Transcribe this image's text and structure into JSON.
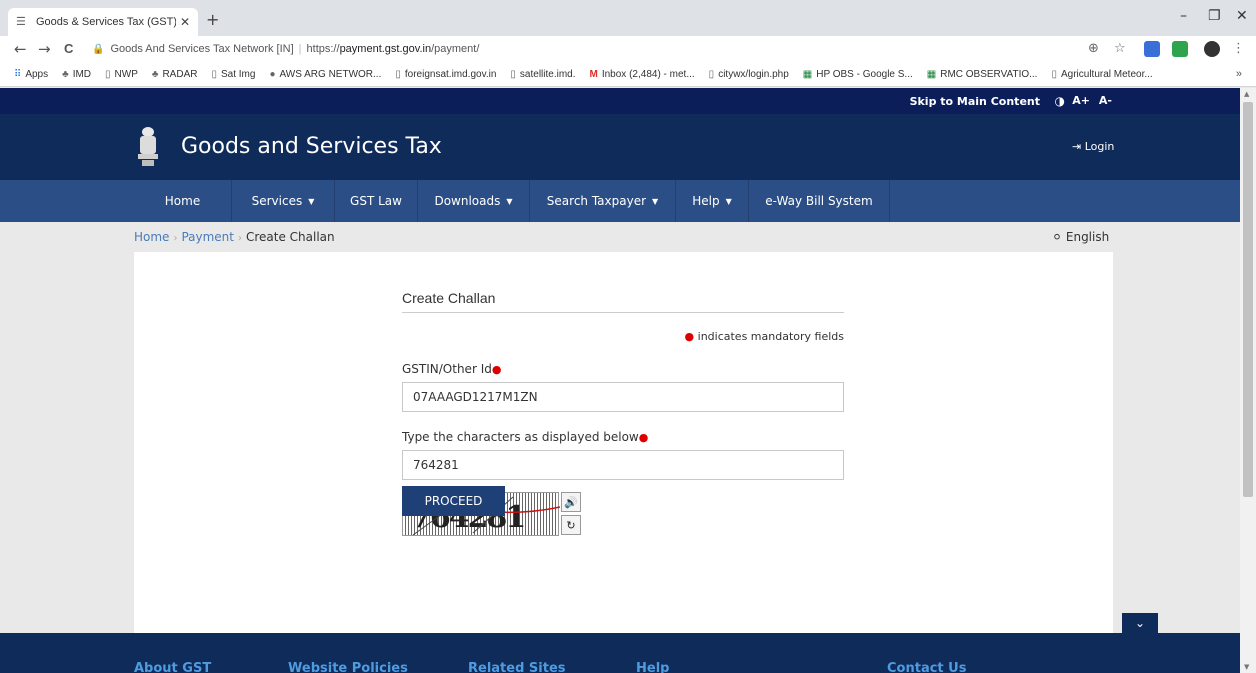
{
  "browser": {
    "tab_title": "Goods & Services Tax (GST) | Pay",
    "new_tab": "+",
    "window": {
      "minimize": "–",
      "restore": "❐",
      "close": "✕"
    },
    "nav": {
      "back": "←",
      "forward": "→",
      "reload": "C"
    },
    "omnibox": {
      "site_name": "Goods And Services Tax Network [IN]",
      "url_prefix": "https://",
      "url_host": "payment.gst.gov.in",
      "url_path": "/payment/"
    },
    "bookmarks": [
      {
        "icon": "apps-icon",
        "label": "Apps"
      },
      {
        "icon": "imd-icon",
        "label": "IMD"
      },
      {
        "icon": "page-icon",
        "label": "NWP"
      },
      {
        "icon": "imd-icon",
        "label": "RADAR"
      },
      {
        "icon": "page-icon",
        "label": "Sat Img"
      },
      {
        "icon": "globe-icon",
        "label": "AWS ARG NETWOR..."
      },
      {
        "icon": "page-icon",
        "label": "foreignsat.imd.gov.in"
      },
      {
        "icon": "page-icon",
        "label": "satellite.imd."
      },
      {
        "icon": "gmail-icon",
        "label": "Inbox (2,484) - met..."
      },
      {
        "icon": "page-icon",
        "label": "citywx/login.php"
      },
      {
        "icon": "sheets-icon",
        "label": "HP OBS - Google S..."
      },
      {
        "icon": "sheets-icon",
        "label": "RMC OBSERVATIO..."
      },
      {
        "icon": "page-icon",
        "label": "Agricultural Meteor..."
      }
    ],
    "bookmarks_more": "»"
  },
  "accessibility_bar": {
    "skip_link": "Skip to Main Content",
    "font_increase": "A+",
    "font_decrease": "A-"
  },
  "header": {
    "title": "Goods and Services Tax",
    "login": "Login"
  },
  "navbar": [
    {
      "label": "Home",
      "caret": false
    },
    {
      "label": "Services",
      "caret": true
    },
    {
      "label": "GST Law",
      "caret": false
    },
    {
      "label": "Downloads",
      "caret": true
    },
    {
      "label": "Search Taxpayer",
      "caret": true
    },
    {
      "label": "Help",
      "caret": true
    },
    {
      "label": "e-Way Bill System",
      "caret": false
    }
  ],
  "breadcrumb": [
    "Home",
    "Payment",
    "Create Challan"
  ],
  "language": "English",
  "form": {
    "title": "Create Challan",
    "mandatory_note": "indicates mandatory fields",
    "gstin_label": "GSTIN/Other Id",
    "gstin_value": "07AAAGD1217M1ZN",
    "captcha_label": "Type the characters as displayed below",
    "captcha_value": "764281",
    "captcha_image_text": "764281",
    "proceed": "PROCEED"
  },
  "footer": {
    "links": [
      "About GST",
      "Website Policies",
      "Related Sites",
      "Help",
      "Contact Us"
    ]
  },
  "colors": {
    "skipbar": "#0b1e59",
    "header": "#0f2b5a",
    "navbar": "#2c4e86",
    "footer_link": "#4f9be0",
    "mandatory_dot": "#dd0000"
  }
}
